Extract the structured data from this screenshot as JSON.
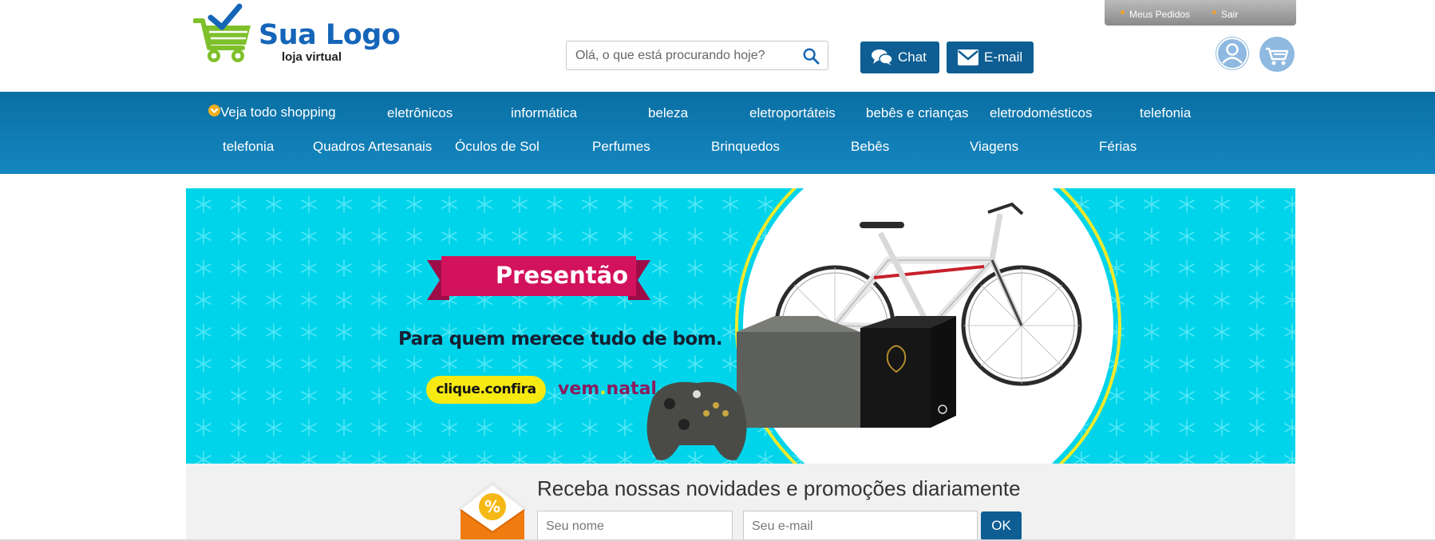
{
  "header": {
    "logo_text": "Sua Logo",
    "logo_subtitle": "loja virtual",
    "top_links": [
      "Meus Pedidos",
      "Sair"
    ],
    "search_placeholder": "Olá, o que está procurando hoje?",
    "chat_label": "Chat",
    "email_label": "E-mail"
  },
  "nav": {
    "row1": [
      "Veja todo shopping",
      "eletrônicos",
      "informática",
      "beleza",
      "eletroportáteis",
      "bebês e crianças",
      "eletrodomésticos",
      "telefonia"
    ],
    "row2": [
      "telefonia",
      "Quadros Artesanais",
      "Óculos de Sol",
      "Perfumes",
      "Brinquedos",
      "Bebês",
      "Viagens",
      "Férias"
    ]
  },
  "banner": {
    "title": "Presentão",
    "subtitle": "Para quem merece tudo de bom.",
    "cta": "clique.confira",
    "tag_part1": "vem",
    "tag_dot": ".",
    "tag_part2": "natal"
  },
  "newsletter": {
    "title": "Receba nossas novidades e promoções diariamente",
    "name_placeholder": "Seu nome",
    "email_placeholder": "Seu e-mail",
    "ok_label": "OK",
    "icon_symbol": "%"
  },
  "colors": {
    "brand_blue": "#0e5e93",
    "nav_blue": "#0a6fa3",
    "logo_green": "#7ec02a",
    "banner_cyan": "#00d4ea",
    "ribbon_pink": "#d3125d"
  }
}
